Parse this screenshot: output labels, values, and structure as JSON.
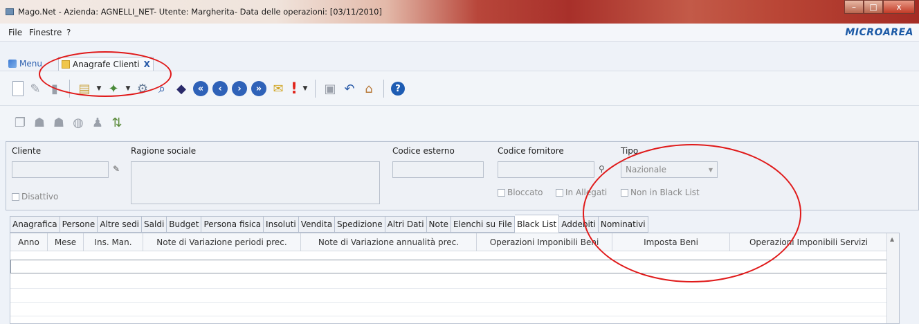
{
  "window": {
    "title": "Mago.Net - Azienda: AGNELLI_NET- Utente: Margherita- Data delle operazioni: [03/11/2010]",
    "controls": {
      "minimize": "–",
      "maximize": "□",
      "close": "x"
    }
  },
  "menu": {
    "items": [
      "File",
      "Finestre",
      "?"
    ],
    "brand": "MICROAREA"
  },
  "doc_tabs": [
    {
      "label": "Menu",
      "icon": "menu-icon"
    },
    {
      "label": "Anagrafe Clienti",
      "icon": "document-icon",
      "close": "X"
    }
  ],
  "form": {
    "cliente_label": "Cliente",
    "cliente_value": "",
    "ragione_label": "Ragione sociale",
    "ragione_value": "",
    "codice_esterno_label": "Codice esterno",
    "codice_esterno_value": "",
    "codice_fornitore_label": "Codice fornitore",
    "codice_fornitore_value": "",
    "tipo_label": "Tipo",
    "tipo_value": "Nazionale",
    "disattivo_label": "Disattivo",
    "bloccato_label": "Bloccato",
    "in_allegati_label": "In Allegati",
    "non_black_list_label": "Non in Black List"
  },
  "tabs": [
    "Anagrafica",
    "Persone",
    "Altre sedi",
    "Saldi",
    "Budget",
    "Persona fisica",
    "Insoluti",
    "Vendita",
    "Spedizione",
    "Altri Dati",
    "Note",
    "Elenchi su File",
    "Black List",
    "Addebiti",
    "Nominativi"
  ],
  "active_tab": "Black List",
  "grid": {
    "columns": [
      "Anno",
      "Mese",
      "Ins. Man.",
      "Note di Variazione periodi prec.",
      "Note di Variazione annualità prec.",
      "Operazioni Imponibili Beni",
      "Imposta Beni",
      "Operazioni Imponibili Servizi"
    ],
    "rows": []
  },
  "colors": {
    "accent": "#1c5aa6",
    "annotation": "#e01a1a"
  }
}
